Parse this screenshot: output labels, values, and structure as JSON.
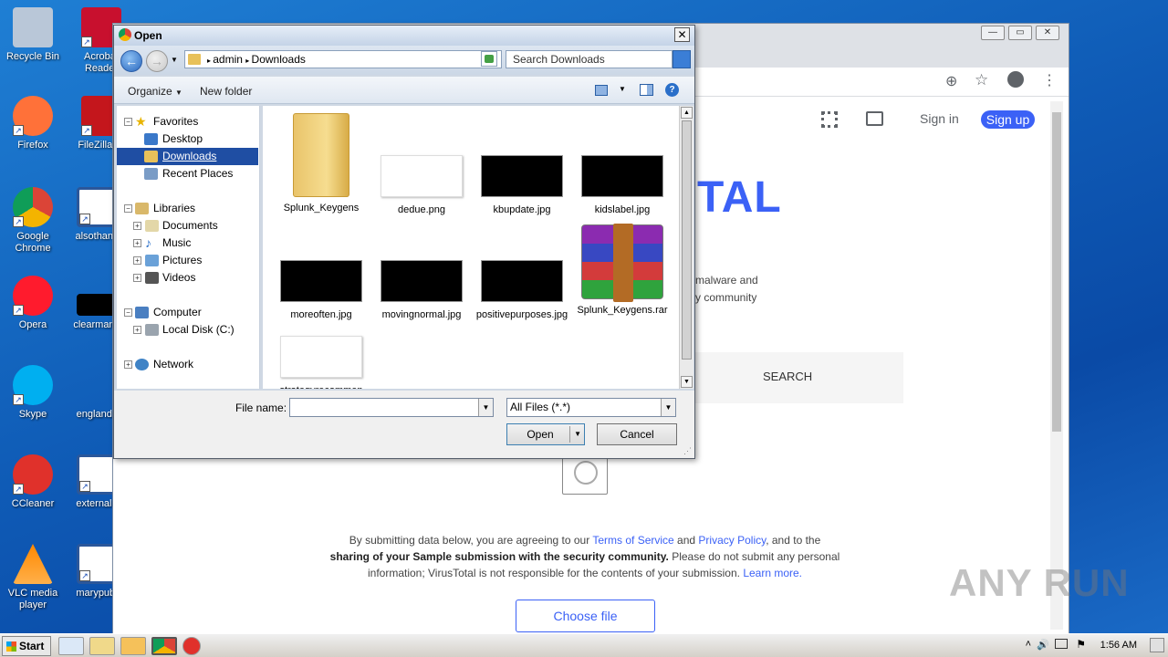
{
  "desktop": {
    "icons": [
      {
        "label": "Recycle Bin",
        "color": "#b9c7d8"
      },
      {
        "label": "Acrobat Reader",
        "color": "#c8102e"
      },
      {
        "label": "Firefox",
        "color": "#ff7139"
      },
      {
        "label": "FileZilla Cl",
        "color": "#c4161c"
      },
      {
        "label": "Google Chrome",
        "color": "#4285f4"
      },
      {
        "label": "alsothank",
        "color": "#2b579a"
      },
      {
        "label": "Opera",
        "color": "#ff1b2d"
      },
      {
        "label": "clearmand",
        "color": "#000000"
      },
      {
        "label": "Skype",
        "color": "#00aff0"
      },
      {
        "label": "englands",
        "color": "#2b579a"
      },
      {
        "label": "CCleaner",
        "color": "#e0312b"
      },
      {
        "label": "externala",
        "color": "#2b579a"
      },
      {
        "label": "VLC media player",
        "color": "#ff8800"
      },
      {
        "label": "marypubl",
        "color": "#2b579a"
      }
    ]
  },
  "chrome_bg": {
    "window_controls": [
      "—",
      "▭",
      "✕"
    ],
    "signin": "Sign in",
    "signup": "Sign up",
    "logo_partial": "TAL",
    "desc_line1": "malware and",
    "desc_line2": "y community",
    "search_tab": "SEARCH",
    "terms_pre": "By submitting data below, you are agreeing to our ",
    "terms_tos": "Terms of Service",
    "terms_and": " and ",
    "terms_pp": "Privacy Policy",
    "terms_post": ", and to the",
    "terms_bold": "sharing of your Sample submission with the security community.",
    "terms_line2b": " Please do not submit any personal",
    "terms_line3": "information; VirusTotal is not responsible for the contents of your submission. ",
    "terms_learn": "Learn more.",
    "choose_file": "Choose file",
    "watermark": "ANY RUN"
  },
  "dialog": {
    "title": "Open",
    "close": "✕",
    "address": {
      "seg1": "admin",
      "seg2": "Downloads"
    },
    "search_placeholder": "Search Downloads",
    "toolbar": {
      "organize": "Organize",
      "new_folder": "New folder"
    },
    "nav": {
      "favorites": "Favorites",
      "desktop": "Desktop",
      "downloads": "Downloads",
      "recent": "Recent Places",
      "libraries": "Libraries",
      "documents": "Documents",
      "music": "Music",
      "pictures": "Pictures",
      "videos": "Videos",
      "computer": "Computer",
      "local_disk": "Local Disk (C:)",
      "network": "Network"
    },
    "files": [
      {
        "name": "Splunk_Keygens",
        "kind": "folder"
      },
      {
        "name": "dedue.png",
        "kind": "white"
      },
      {
        "name": "kbupdate.jpg",
        "kind": "black"
      },
      {
        "name": "kidslabel.jpg",
        "kind": "black"
      },
      {
        "name": "moreoften.jpg",
        "kind": "black"
      },
      {
        "name": "movingnormal.jpg",
        "kind": "black"
      },
      {
        "name": "positivepurposes.jpg",
        "kind": "black"
      },
      {
        "name": "Splunk_Keygens.rar",
        "kind": "rar"
      },
      {
        "name": "strategyrecommen",
        "kind": "white"
      }
    ],
    "file_name_label": "File name:",
    "file_name_value": "",
    "file_type": "All Files (*.*)",
    "open": "Open",
    "cancel": "Cancel"
  },
  "taskbar": {
    "start": "Start",
    "clock": "1:56 AM"
  }
}
